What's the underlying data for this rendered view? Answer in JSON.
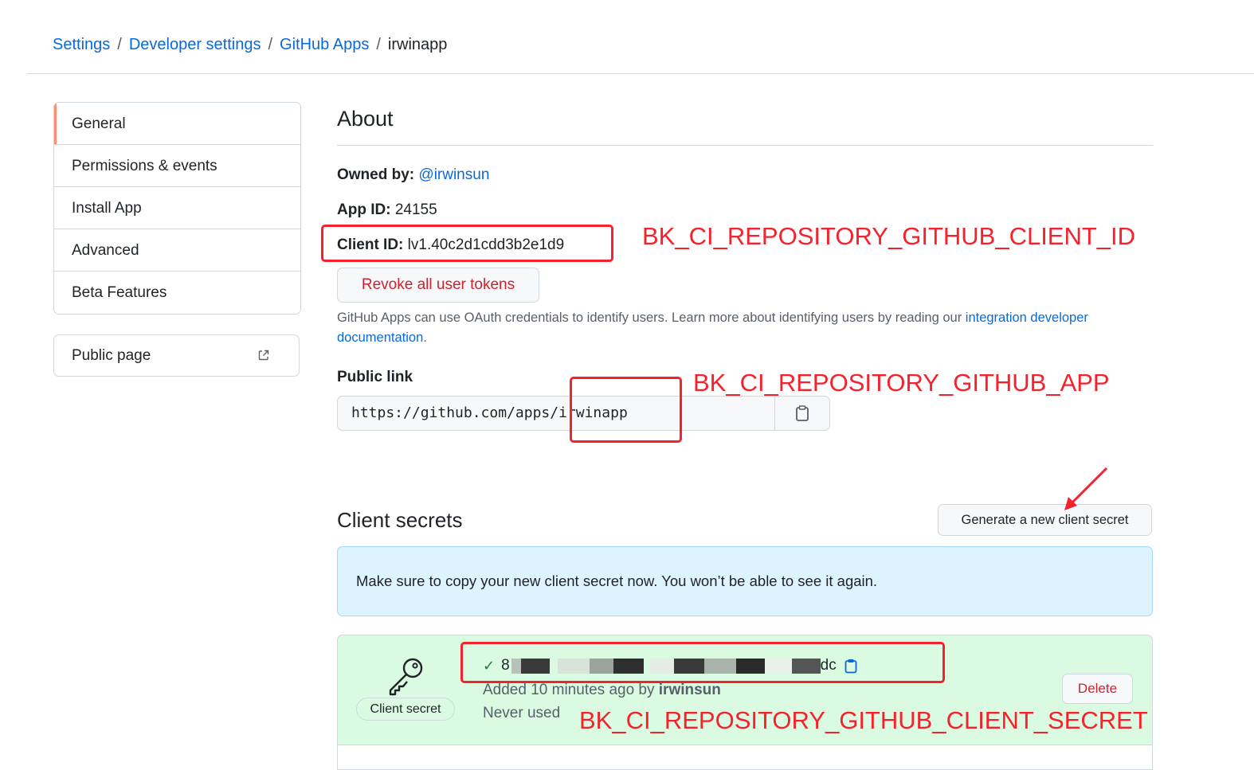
{
  "breadcrumb": {
    "settings": "Settings",
    "developer_settings": "Developer settings",
    "github_apps": "GitHub Apps",
    "current": "irwinapp",
    "separator": "/"
  },
  "sidebar": {
    "items": [
      {
        "label": "General",
        "selected": true
      },
      {
        "label": "Permissions & events"
      },
      {
        "label": "Install App"
      },
      {
        "label": "Advanced"
      },
      {
        "label": "Beta Features"
      }
    ],
    "public_page": "Public page"
  },
  "about": {
    "title": "About",
    "owned_by_label": "Owned by:",
    "owner": "@irwinsun",
    "app_id_label": "App ID:",
    "app_id": "24155",
    "client_id_label": "Client ID:",
    "client_id": "lv1.40c2d1cdd3b2e1d9",
    "revoke_button": "Revoke all user tokens",
    "help_text": "GitHub Apps can use OAuth credentials to identify users. Learn more about identifying users by reading our ",
    "help_link": "integration developer documentation",
    "help_end": ".",
    "public_link_label": "Public link",
    "public_link_value": "https://github.com/apps/irwinapp"
  },
  "client_secrets": {
    "title": "Client secrets",
    "generate_button": "Generate a new client secret",
    "flash_message": "Make sure to copy your new client secret now. You won’t be able to see it again.",
    "secret_badge": "Client secret",
    "secret_prefix": "8",
    "secret_suffix": "dc",
    "added_text": "Added 10 minutes ago by ",
    "added_by": "irwinsun",
    "usage": "Never used",
    "delete_button": "Delete"
  },
  "annotations": {
    "client_id": "BK_CI_REPOSITORY_GITHUB_CLIENT_ID",
    "app": "BK_CI_REPOSITORY_GITHUB_APP",
    "client_secret": "BK_CI_REPOSITORY_GITHUB_CLIENT_SECRET"
  },
  "colors": {
    "link": "#0969da",
    "danger": "#cf222e",
    "annotation": "#f5222d",
    "flash_bg": "#ddf4ff",
    "success_bg": "#dafbe1"
  }
}
